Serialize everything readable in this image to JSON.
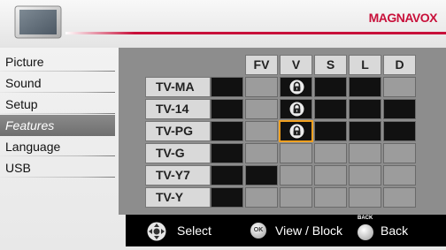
{
  "header": {
    "brand": "MAGNAVOX",
    "icon": "tv-icon"
  },
  "menu": {
    "items": [
      {
        "label": "Picture"
      },
      {
        "label": "Sound"
      },
      {
        "label": "Setup"
      },
      {
        "label": "Features",
        "selected": true
      },
      {
        "label": "Language"
      },
      {
        "label": "USB"
      }
    ]
  },
  "grid": {
    "columns": [
      "FV",
      "V",
      "S",
      "L",
      "D"
    ],
    "rows": [
      {
        "label": "TV-MA",
        "cells": [
          "black",
          "gray",
          "black-lock",
          "black",
          "black",
          "gray"
        ]
      },
      {
        "label": "TV-14",
        "cells": [
          "black",
          "gray",
          "black-lock",
          "black",
          "black",
          "black"
        ]
      },
      {
        "label": "TV-PG",
        "cells": [
          "black",
          "gray",
          "black-lock-focused",
          "black",
          "black",
          "black"
        ]
      },
      {
        "label": "TV-G",
        "cells": [
          "black",
          "gray",
          "gray",
          "gray",
          "gray",
          "gray"
        ]
      },
      {
        "label": "TV-Y7",
        "cells": [
          "black",
          "black",
          "gray",
          "gray",
          "gray",
          "gray"
        ]
      },
      {
        "label": "TV-Y",
        "cells": [
          "black",
          "gray",
          "gray",
          "gray",
          "gray",
          "gray"
        ]
      }
    ],
    "colors": {
      "blocked": "#111111",
      "unblocked": "#9c9c9c",
      "focus": "#f0a020"
    }
  },
  "bottom": {
    "select_label": "Select",
    "ok_label": "OK",
    "viewblock_label": "View / Block",
    "back_top": "BACK",
    "back_label": "Back"
  }
}
